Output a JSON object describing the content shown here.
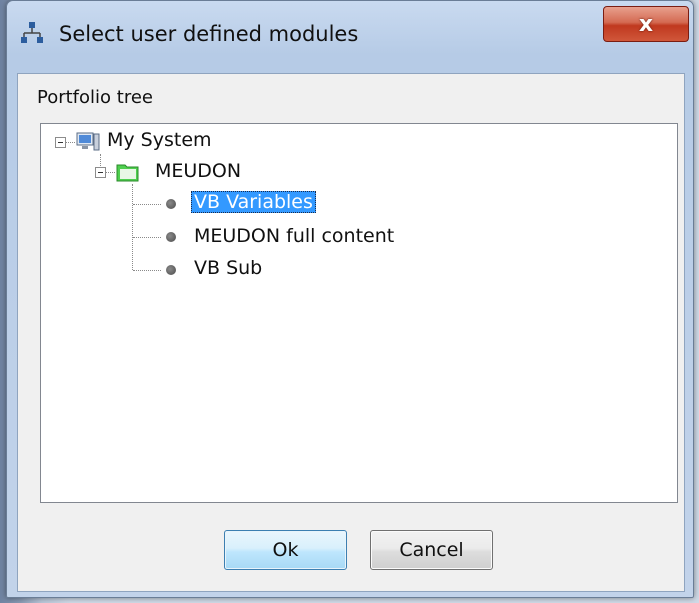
{
  "window": {
    "title": "Select user defined modules",
    "close_glyph": "x"
  },
  "group": {
    "label": "Portfolio tree"
  },
  "tree": {
    "root": {
      "label": "My System",
      "icon": "computer-icon",
      "expanded": true
    },
    "folder": {
      "label": "MEUDON",
      "icon": "folder-icon",
      "expanded": true
    },
    "items": [
      {
        "label": "VB Variables",
        "selected": true
      },
      {
        "label": "MEUDON full content",
        "selected": false
      },
      {
        "label": "VB Sub",
        "selected": false
      }
    ]
  },
  "buttons": {
    "ok": "Ok",
    "cancel": "Cancel"
  },
  "colors": {
    "selection": "#3399ff",
    "close_button": "#c0391f",
    "folder_green": "#3fbf3f"
  }
}
